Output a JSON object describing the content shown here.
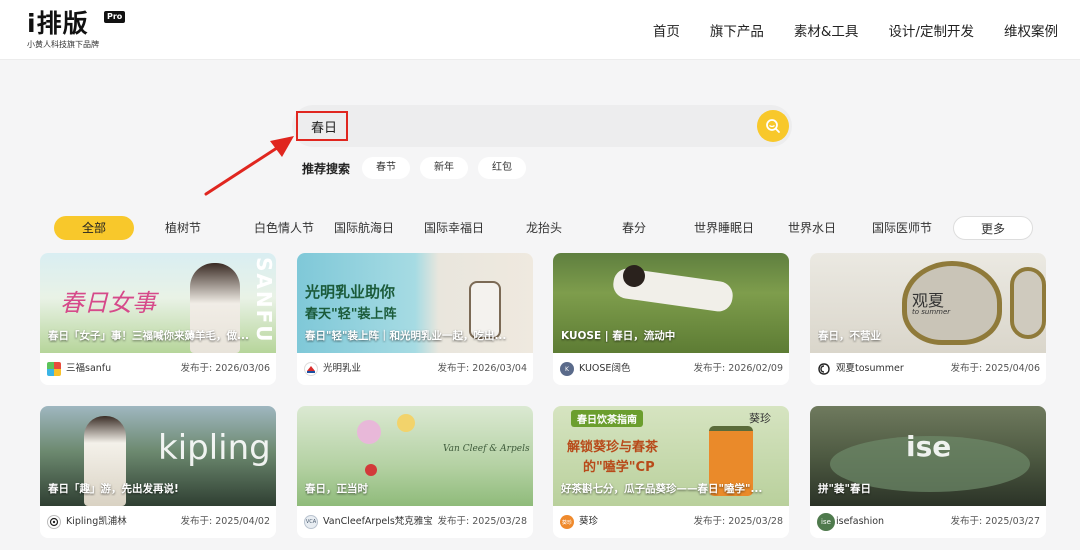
{
  "brand": {
    "name": "i排版",
    "badge": "Pro",
    "slogan": "小黄人科技旗下品牌"
  },
  "nav": [
    "首页",
    "旗下产品",
    "素材&工具",
    "设计/定制开发",
    "维权案例"
  ],
  "search": {
    "value": "春日"
  },
  "recommend": {
    "label": "推荐搜索",
    "tags": [
      "春节",
      "新年",
      "红包"
    ]
  },
  "categories": [
    "全部",
    "植树节",
    "白色情人节",
    "国际航海日",
    "国际幸福日",
    "龙抬头",
    "春分",
    "世界睡眠日",
    "世界水日",
    "国际医师节",
    "更多"
  ],
  "date_label": "发布于:",
  "cards": [
    {
      "title": "春日「女子」事！三福喊你来薅羊毛，做...",
      "author": "三福sanfu",
      "date": "2026/03/06",
      "img_text": [
        "春日女事",
        "SANFU"
      ]
    },
    {
      "title": "春日\"轻\"装上阵｜和光明乳业一起，吃出...",
      "author": "光明乳业",
      "date": "2026/03/04",
      "img_text": [
        "光明乳业助你",
        "春天\"轻\"装上阵"
      ]
    },
    {
      "title": "KUOSE | 春日，流动中",
      "author": "KUOSE阔色",
      "date": "2026/02/09",
      "img_text": []
    },
    {
      "title": "春日，不营业",
      "author": "观夏tosummer",
      "date": "2025/04/06",
      "img_text": [
        "观夏",
        "to summer"
      ]
    },
    {
      "title": "春日「趣」游，先出发再说!",
      "author": "Kipling凯浦林",
      "date": "2025/04/02",
      "img_text": [
        "kipling"
      ]
    },
    {
      "title": "春日，正当时",
      "author": "VanCleefArpels梵克雅宝",
      "date": "2025/03/28",
      "img_text": [
        "Van Cleef & Arpels"
      ]
    },
    {
      "title": "好茶斟七分，瓜子品葵珍——春日\"嗑学\"...",
      "author": "葵珍",
      "date": "2025/03/28",
      "img_text": [
        "春日饮茶指南",
        "解锁葵珍与春茶",
        "的\"嗑学\"CP",
        "葵珍"
      ]
    },
    {
      "title": "拼\"装\"春日",
      "author": "isefashion",
      "date": "2025/03/27",
      "img_text": [
        "ise"
      ]
    }
  ],
  "colors": {
    "accent": "#f8c82b",
    "highlight": "#e0261f"
  }
}
